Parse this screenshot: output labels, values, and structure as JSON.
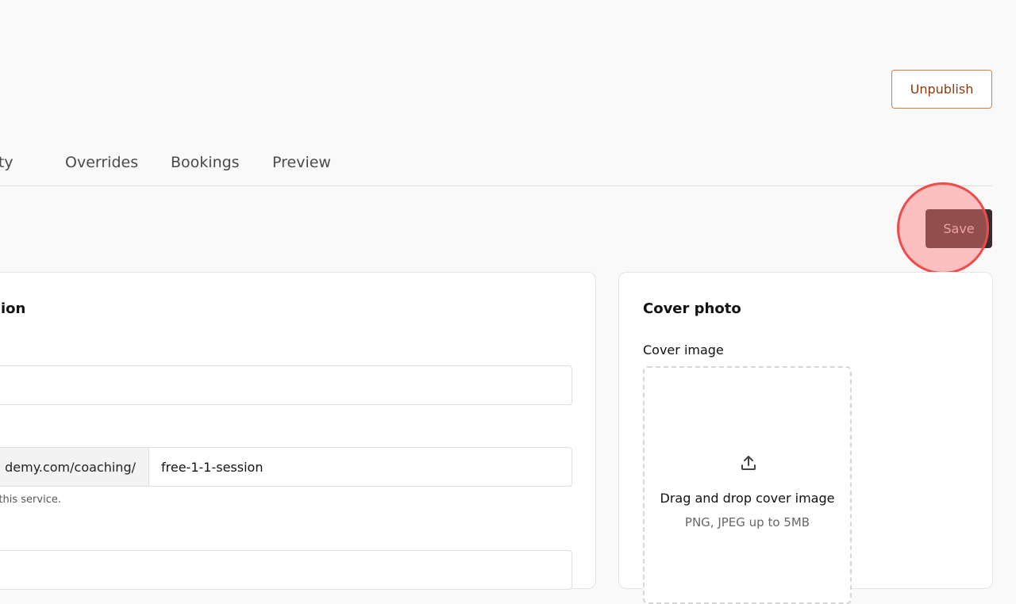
{
  "header": {
    "unpublish_label": "Unpublish",
    "save_label": "Save"
  },
  "tabs": [
    {
      "label": "bility"
    },
    {
      "label": "Overrides"
    },
    {
      "label": "Bookings"
    },
    {
      "label": "Preview"
    }
  ],
  "details_card": {
    "title": "ion",
    "url_prefix": "demy.com/coaching/",
    "url_slug": "free-1-1-session",
    "url_help": "or this service."
  },
  "cover_card": {
    "title": "Cover photo",
    "field_label": "Cover image",
    "dropzone_title": "Drag and drop cover image",
    "dropzone_hint": "PNG, JPEG up to 5MB",
    "icon": "upload-icon"
  },
  "colors": {
    "unpublish_border": "#d97a3e",
    "unpublish_text": "#8a3a12",
    "save_bg": "#3b2b2b",
    "click_indicator": "#ee4b4b"
  }
}
